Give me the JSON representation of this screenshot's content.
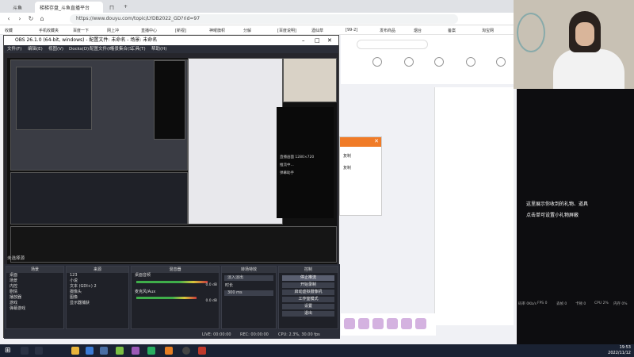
{
  "browser": {
    "tabs": [
      "斗鱼",
      "梯梯存盘_斗鱼直播平台",
      "ㄇ",
      "+"
    ],
    "url": "https://www.douyu.com/topic/LYDB2022_GD?rid=97",
    "bookmarks": [
      "收藏",
      "手机收藏夹",
      "百度一下",
      "网上冲",
      "直播中心",
      "[新视]",
      "神曜旗帜",
      "分解",
      "[百度说明]",
      "酒仙草",
      "[99-2]",
      "发布商品",
      "烟台",
      "备案",
      "淘宝网",
      "ED/USE",
      "我爱工作",
      "小幽鬼"
    ]
  },
  "popup": {
    "rows": [
      "复制",
      "复制"
    ]
  },
  "obs": {
    "title": "OBS 26.1.0 (64-bit, windows) - 配置文件: 未命名 - 场景: 未命名",
    "menu": [
      "文件(F)",
      "编辑(E)",
      "视图(V)",
      "Docks(D)",
      "配置文件(P)",
      "场景集合(S)",
      "工具(T)",
      "帮助(H)"
    ],
    "scene_label": "未选择源",
    "docks": {
      "scenes": {
        "title": "场景",
        "items": [
          "桌面",
          "场景",
          "内控",
          "剧情",
          "播放器",
          "游戏",
          "弹幕游戏"
        ]
      },
      "sources": {
        "title": "来源",
        "items": [
          "123",
          "小说",
          "文本 (GDI+) 2",
          "摄像头",
          "图像",
          "显示器捕获"
        ]
      },
      "mixer": {
        "title": "混音器",
        "channels": [
          "桌面音频",
          "麦克风/Aux"
        ],
        "levels": [
          "0.0 dB",
          "0.0 dB"
        ]
      },
      "transitions": {
        "title": "转场特效",
        "value": "淡入淡出",
        "duration_label": "时长",
        "duration": "300 ms"
      },
      "controls": {
        "title": "控制",
        "buttons": [
          "停止推流",
          "开始录制",
          "启动虚拟摄像机",
          "工作室模式",
          "设置",
          "退出"
        ]
      }
    },
    "status": {
      "live": "LIVE: 00:00:00",
      "rec": "REC: 00:00:00",
      "cpu": "CPU: 2.3%, 30.00 fps"
    }
  },
  "camera": {},
  "chat": {
    "tip1": "这里展示你收到的礼物、道具",
    "tip2": "点击单可设置小礼物屏蔽",
    "stats": [
      "码率 0Kb/s",
      "FPS 0",
      "丢帧 0",
      "卡顿 0",
      "CPU 2%",
      "内存 0%"
    ]
  },
  "monitor": {
    "lines": [
      "直播画面 1280×720",
      "推流中...",
      "弹幕助手"
    ]
  },
  "taskbar": {
    "time": "19:53",
    "date": "2022/11/12"
  },
  "colors": {
    "obs_bg": "#26262c",
    "obs_dock": "#2b2e38",
    "accent": "#f07b27",
    "taskbar": "#1a2233"
  }
}
